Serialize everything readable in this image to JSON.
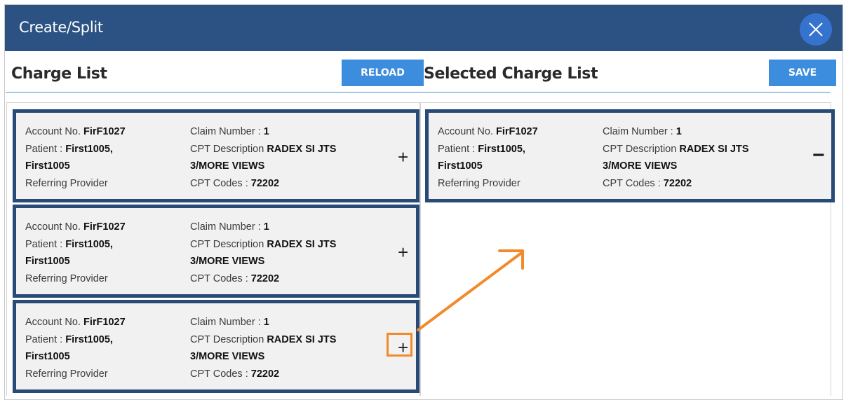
{
  "dialog": {
    "title": "Create/Split"
  },
  "charge_list": {
    "heading": "Charge List",
    "reload_label": "RELOAD",
    "cards": [
      {
        "account_label": "Account No.",
        "account_value": "FirF1027",
        "patient_label": "Patient :",
        "patient_value_1": "First1005,",
        "patient_value_2": "First1005",
        "referring_label": "Referring Provider",
        "claim_label": "Claim Number :",
        "claim_value": "1",
        "cpt_desc_label": "CPT Description",
        "cpt_desc_value_1": "RADEX SI JTS",
        "cpt_desc_value_2": "3/MORE VIEWS",
        "cpt_codes_label": "CPT Codes :",
        "cpt_codes_value": "72202",
        "action": "+"
      },
      {
        "account_label": "Account No.",
        "account_value": "FirF1027",
        "patient_label": "Patient :",
        "patient_value_1": "First1005,",
        "patient_value_2": "First1005",
        "referring_label": "Referring Provider",
        "claim_label": "Claim Number :",
        "claim_value": "1",
        "cpt_desc_label": "CPT Description",
        "cpt_desc_value_1": "RADEX SI JTS",
        "cpt_desc_value_2": "3/MORE VIEWS",
        "cpt_codes_label": "CPT Codes :",
        "cpt_codes_value": "72202",
        "action": "+"
      },
      {
        "account_label": "Account No.",
        "account_value": "FirF1027",
        "patient_label": "Patient :",
        "patient_value_1": "First1005,",
        "patient_value_2": "First1005",
        "referring_label": "Referring Provider",
        "claim_label": "Claim Number :",
        "claim_value": "1",
        "cpt_desc_label": "CPT Description",
        "cpt_desc_value_1": "RADEX SI JTS",
        "cpt_desc_value_2": "3/MORE VIEWS",
        "cpt_codes_label": "CPT Codes :",
        "cpt_codes_value": "72202",
        "action": "+"
      }
    ]
  },
  "selected_list": {
    "heading": "Selected Charge List",
    "save_label": "SAVE",
    "cards": [
      {
        "account_label": "Account No.",
        "account_value": "FirF1027",
        "patient_label": "Patient :",
        "patient_value_1": "First1005,",
        "patient_value_2": "First1005",
        "referring_label": "Referring Provider",
        "claim_label": "Claim Number :",
        "claim_value": "1",
        "cpt_desc_label": "CPT Description",
        "cpt_desc_value_1": "RADEX SI JTS",
        "cpt_desc_value_2": "3/MORE VIEWS",
        "cpt_codes_label": "CPT Codes :",
        "cpt_codes_value": "72202",
        "action": "−"
      }
    ]
  },
  "colors": {
    "header": "#2c5283",
    "button": "#3c8dde",
    "card_border": "#284a77",
    "highlight": "#f28a2a"
  },
  "icons": {
    "close": "close-icon",
    "add": "plus-icon",
    "remove": "minus-icon",
    "annotation": "arrow-icon"
  }
}
